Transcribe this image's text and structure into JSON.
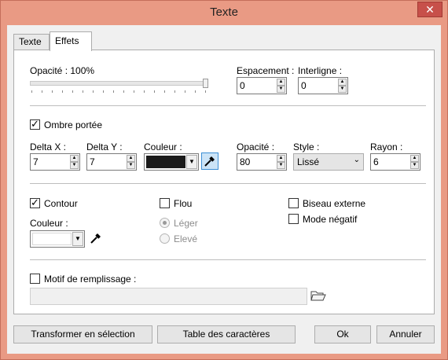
{
  "window": {
    "title": "Texte",
    "close_glyph": "✕"
  },
  "tabs": [
    {
      "label": "Texte",
      "active": false
    },
    {
      "label": "Effets",
      "active": true
    }
  ],
  "opacity": {
    "label": "Opacité : 100%",
    "level_percent": 100
  },
  "spacing": {
    "label": "Espacement :",
    "value": "0"
  },
  "line_spacing": {
    "label": "Interligne :",
    "value": "0"
  },
  "shadow": {
    "checkbox_label": "Ombre portée",
    "checked": true,
    "delta_x": {
      "label": "Delta X :",
      "value": "7"
    },
    "delta_y": {
      "label": "Delta Y :",
      "value": "7"
    },
    "color": {
      "label": "Couleur :",
      "hex": "#1a1a1a"
    },
    "opacity": {
      "label": "Opacité :",
      "value": "80"
    },
    "style": {
      "label": "Style :",
      "value": "Lissé"
    },
    "radius": {
      "label": "Rayon :",
      "value": "6"
    }
  },
  "outline": {
    "checkbox_label": "Contour",
    "checked": true,
    "color_label": "Couleur :",
    "color_hex": "#ffffff"
  },
  "blur": {
    "checkbox_label": "Flou",
    "checked": false,
    "option_light": "Léger",
    "option_high": "Elevé",
    "selected": "Léger"
  },
  "bevel": {
    "checkbox_label": "Biseau externe",
    "checked": false
  },
  "negative": {
    "checkbox_label": "Mode négatif",
    "checked": false
  },
  "fill_pattern": {
    "checkbox_label": "Motif de remplissage :",
    "checked": false,
    "value": ""
  },
  "buttons": {
    "transform": "Transformer en sélection",
    "charmap": "Table des caractères",
    "ok": "Ok",
    "cancel": "Annuler"
  },
  "icons": {
    "picker": "eyedropper-icon",
    "folder": "folder-open-icon",
    "arrow_up": "▲",
    "arrow_down": "▼",
    "combo_arrow": "⌄"
  },
  "colors": {
    "accent": "#3d8fd6",
    "window_border": "#e99a84"
  }
}
